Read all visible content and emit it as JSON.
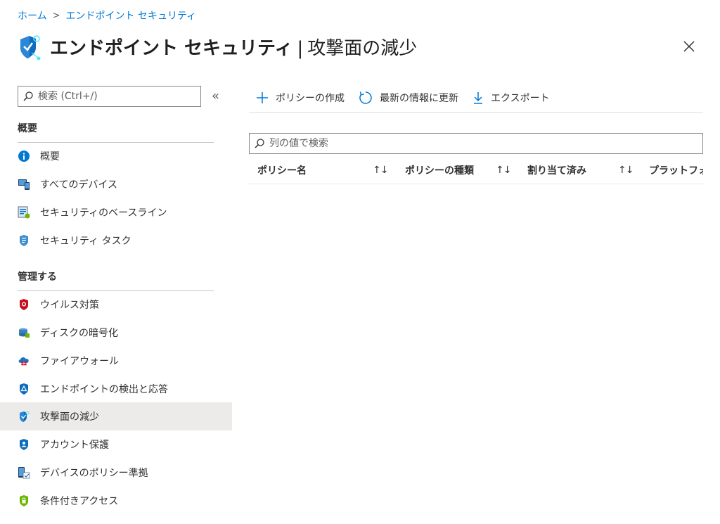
{
  "breadcrumb": {
    "home": "ホーム",
    "separator": ">",
    "current": "エンドポイント セキュリティ"
  },
  "header": {
    "title_main": "エンドポイント セキュリティ",
    "title_sep": "|",
    "title_sub": "攻撃面の減少",
    "icon": "shield-check-icon",
    "close_icon": "close-icon"
  },
  "sidebar": {
    "search_placeholder": "検索 (Ctrl+/)",
    "collapse_label": "«",
    "sections": [
      {
        "title": "概要",
        "items": [
          {
            "label": "概要",
            "icon": "info-icon"
          },
          {
            "label": "すべてのデバイス",
            "icon": "devices-icon"
          },
          {
            "label": "セキュリティのベースライン",
            "icon": "baseline-icon"
          },
          {
            "label": "セキュリティ タスク",
            "icon": "task-shield-icon"
          }
        ]
      },
      {
        "title": "管理する",
        "items": [
          {
            "label": "ウイルス対策",
            "icon": "antivirus-shield-icon"
          },
          {
            "label": "ディスクの暗号化",
            "icon": "disk-encryption-icon"
          },
          {
            "label": "ファイアウォール",
            "icon": "firewall-icon"
          },
          {
            "label": "エンドポイントの検出と応答",
            "icon": "detection-shield-icon"
          },
          {
            "label": "攻撃面の減少",
            "icon": "attack-surface-icon",
            "active": true
          },
          {
            "label": "アカウント保護",
            "icon": "account-protection-icon"
          },
          {
            "label": "デバイスのポリシー準拠",
            "icon": "compliance-icon"
          },
          {
            "label": "条件付きアクセス",
            "icon": "conditional-access-icon"
          }
        ]
      }
    ]
  },
  "toolbar": {
    "create_label": "ポリシーの作成",
    "refresh_label": "最新の情報に更新",
    "export_label": "エクスポート"
  },
  "filter": {
    "placeholder": "列の値で検索"
  },
  "table": {
    "columns": [
      "ポリシー名",
      "ポリシーの種類",
      "割り当て済み",
      "プラットフォーム"
    ],
    "sort_glyph": "↑↓"
  },
  "colors": {
    "accent": "#0078d4",
    "active_bg": "#edebe9",
    "antivirus_red": "#c50f1f",
    "shield_blue": "#0f6cbd",
    "green": "#6bb700"
  }
}
